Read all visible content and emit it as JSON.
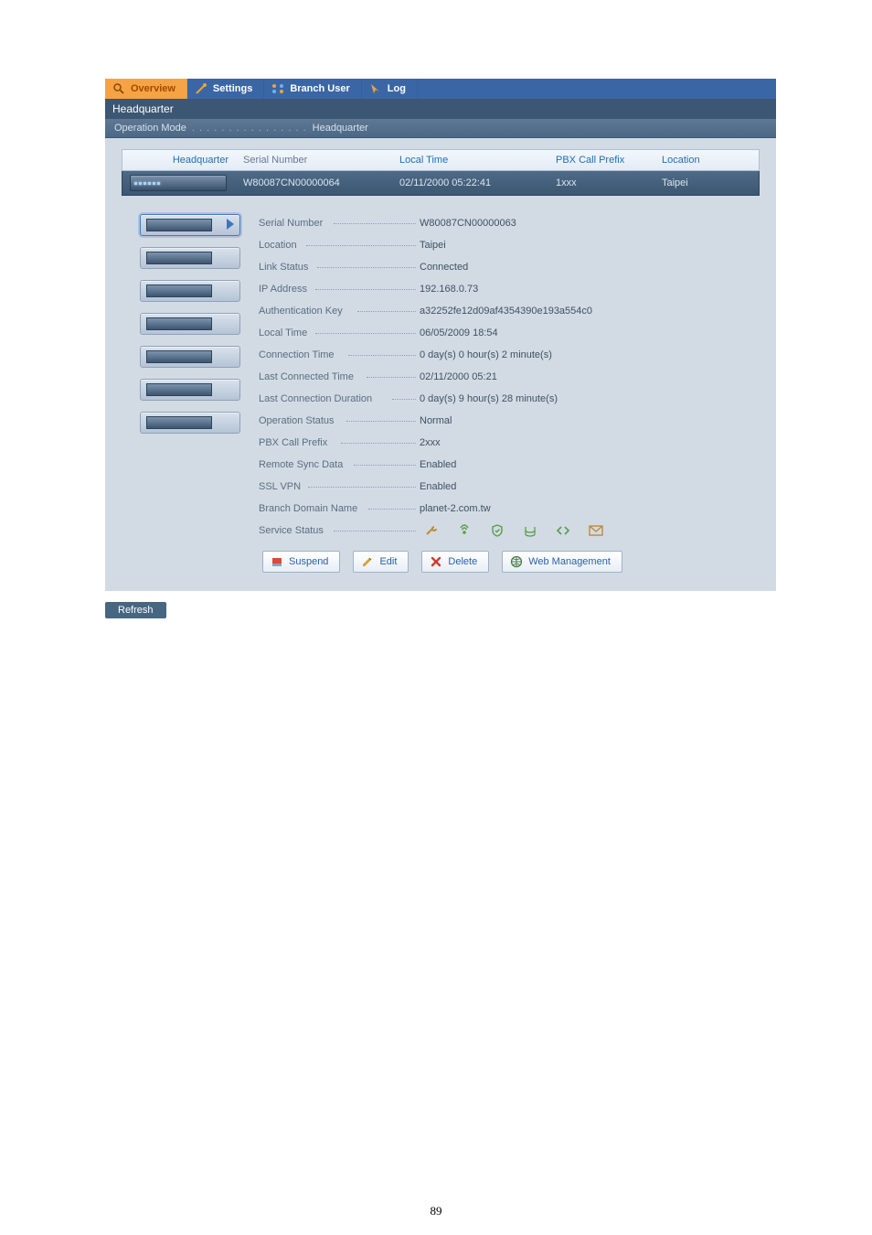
{
  "tabs": {
    "overview": "Overview",
    "settings": "Settings",
    "branch_user": "Branch User",
    "log": "Log"
  },
  "title": "Headquarter",
  "operation_mode": {
    "label": "Operation Mode",
    "value": "Headquarter"
  },
  "columns": {
    "headquarter": "Headquarter",
    "serial": "Serial Number",
    "local_time": "Local Time",
    "pbx_prefix": "PBX Call Prefix",
    "location": "Location"
  },
  "row": {
    "serial": "W80087CN00000064",
    "local_time": "02/11/2000 05:22:41",
    "pbx_prefix": "1xxx",
    "location": "Taipei"
  },
  "details": [
    {
      "label": "Serial Number",
      "value": "W80087CN00000063",
      "lblw": "82px"
    },
    {
      "label": "Location",
      "value": "Taipei",
      "lblw": "52px"
    },
    {
      "label": "Link Status",
      "value": "Connected",
      "lblw": "64px"
    },
    {
      "label": "IP Address",
      "value": "192.168.0.73",
      "lblw": "62px"
    },
    {
      "label": "Authentication Key",
      "value": "a32252fe12d09af4354390e193a554c0",
      "lblw": "108px"
    },
    {
      "label": "Local Time",
      "value": "06/05/2009 18:54",
      "lblw": "62px"
    },
    {
      "label": "Connection Time",
      "value": "0 day(s) 0 hour(s) 2 minute(s)",
      "lblw": "98px"
    },
    {
      "label": "Last Connected Time",
      "value": "02/11/2000 05:21",
      "lblw": "118px"
    },
    {
      "label": "Last Connection Duration",
      "value": "0 day(s) 9 hour(s) 28 minute(s)",
      "lblw": "146px"
    },
    {
      "label": "Operation Status",
      "value": "Normal",
      "lblw": "96px"
    },
    {
      "label": "PBX Call Prefix",
      "value": "2xxx",
      "lblw": "90px"
    },
    {
      "label": "Remote Sync Data",
      "value": "Enabled",
      "lblw": "104px"
    },
    {
      "label": "SSL VPN",
      "value": "Enabled",
      "lblw": "54px"
    },
    {
      "label": "Branch Domain Name",
      "value": "planet-2.com.tw",
      "lblw": "120px"
    }
  ],
  "service_status_label": "Service Status",
  "buttons": {
    "suspend": "Suspend",
    "edit": "Edit",
    "delete": "Delete",
    "web_mgmt": "Web Management",
    "refresh": "Refresh"
  },
  "page_number": "89"
}
